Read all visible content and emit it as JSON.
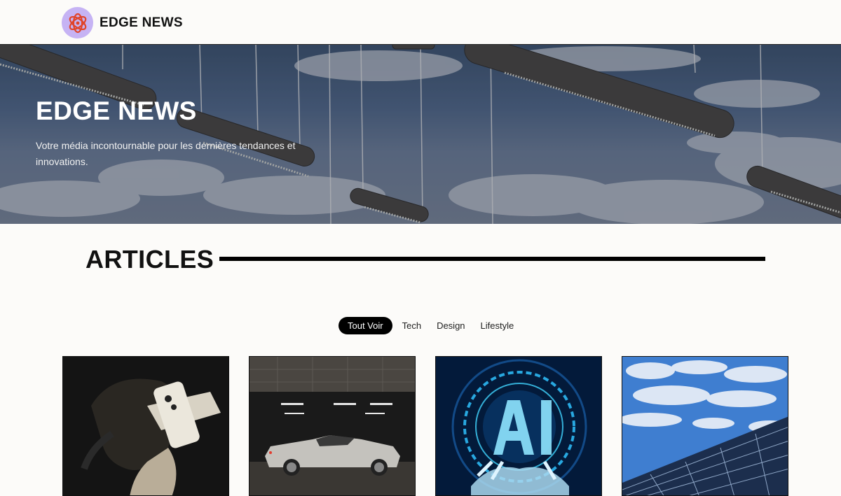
{
  "header": {
    "brand_name": "EDGE NEWS",
    "logo_icon": "atom-icon",
    "logo_bg": "#c6b3f4"
  },
  "hero": {
    "title": "EDGE NEWS",
    "subtitle": "Votre média incontournable pour les dernières tendances et innovations."
  },
  "articles": {
    "title": "ARTICLES",
    "filters": [
      "Tout Voir",
      "Tech",
      "Design",
      "Lifestyle"
    ],
    "active_filter": "Tout Voir",
    "cards": [
      {
        "image": "vr-headset-woman"
      },
      {
        "image": "silver-car-garage"
      },
      {
        "image": "ai-hologram-hand"
      },
      {
        "image": "solar-panels-sky"
      }
    ]
  },
  "colors": {
    "accent": "#000000",
    "background": "#fcfbf9"
  }
}
